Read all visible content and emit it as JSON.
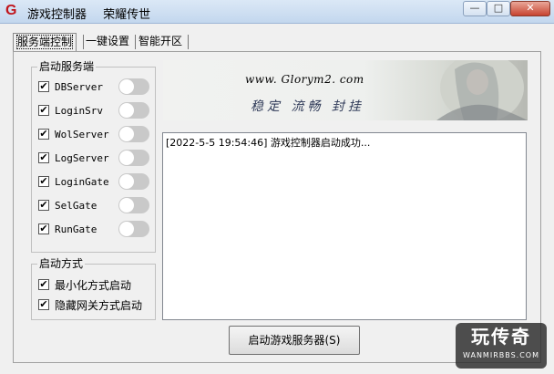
{
  "window": {
    "app_name": "游戏控制器",
    "subtitle": "荣耀传世",
    "min_glyph": "—",
    "max_glyph": "□",
    "close_glyph": "✕"
  },
  "tabs": [
    {
      "label": "服务端控制",
      "active": true
    },
    {
      "label": "一键设置",
      "active": false
    },
    {
      "label": "智能开区",
      "active": false
    }
  ],
  "servers_group": {
    "title": "启动服务端",
    "items": [
      {
        "label": "DBServer",
        "checked": true,
        "check": "✔"
      },
      {
        "label": "LoginSrv",
        "checked": true,
        "check": "✔"
      },
      {
        "label": "WolServer",
        "checked": true,
        "check": "✔"
      },
      {
        "label": "LogServer",
        "checked": true,
        "check": "✔"
      },
      {
        "label": "LoginGate",
        "checked": true,
        "check": "✔"
      },
      {
        "label": "SelGate",
        "checked": true,
        "check": "✔"
      },
      {
        "label": "RunGate",
        "checked": true,
        "check": "✔"
      }
    ]
  },
  "start_mode_group": {
    "title": "启动方式",
    "items": [
      {
        "label": "最小化方式启动",
        "checked": true,
        "check": "✔"
      },
      {
        "label": "隐藏网关方式启动",
        "checked": true,
        "check": "✔"
      }
    ]
  },
  "banner": {
    "url": "www. Glorym2. com",
    "slogan": "稳定 流畅 封挂"
  },
  "log": {
    "lines": [
      "[2022-5-5 19:54:46] 游戏控制器启动成功..."
    ]
  },
  "start_button": {
    "label": "启动游戏服务器(S)"
  },
  "watermark": {
    "main": "玩传奇",
    "sub": "WANMIRBBS.COM"
  }
}
